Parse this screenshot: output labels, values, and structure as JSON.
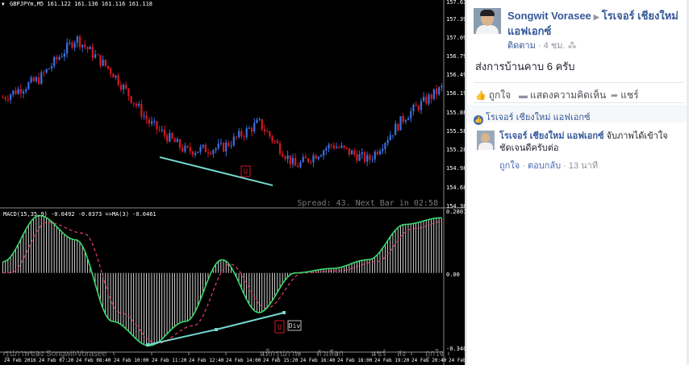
{
  "chart": {
    "symbol_header": "GBPJPYm,M5  161.122 161.136 161.116 161.118",
    "spread_text": "Spread: 43. Next Bar in 02:58",
    "macd_header": "MACD(15,35,9) -0.0492 -0.0373 =>MA(3) -0.0461",
    "price_ticks": [
      "157.630",
      "157.395",
      "157.090",
      "156.790",
      "156.490",
      "156.190",
      "155.885",
      "155.585",
      "155.285",
      "154.985",
      "154.680",
      "154.380"
    ],
    "macd_ticks": [
      "0.2801",
      "0.00",
      "-0.3407"
    ],
    "time_ticks": [
      "24 Feb 2016",
      "24 Feb 07:20",
      "24 Feb 08:40",
      "24 Feb 10:00",
      "24 Feb 11:20",
      "24 Feb 12:40",
      "24 Feb 14:00",
      "24 Feb 15:20",
      "24 Feb 16:40",
      "24 Feb 18:00",
      "24 Feb 19:20",
      "24 Feb 20:40",
      "24 Feb 22:00"
    ],
    "marker_u": "U",
    "marker_div": "Div",
    "watermark": "รูปภาพของ Songwit Vorasee",
    "watermark_menu": [
      "แท็กรูปภาพ",
      "ตัวเลือก",
      "แชร์",
      "ส่ง",
      "ถูกใจ"
    ],
    "colors": {
      "background": "#000000",
      "bull": "#3b6fe0",
      "bear": "#d21a22",
      "trendline": "#76d7d0",
      "macd_line": "#3ad86a",
      "signal_line": "#e0406a",
      "histogram": "#ffffff"
    }
  },
  "chart_data": [
    {
      "type": "candlestick",
      "title": "GBPJPYm,M5",
      "ylim": [
        154.38,
        157.63
      ],
      "x": [
        "24 Feb 2016",
        "24 Feb 07:20",
        "24 Feb 08:40",
        "24 Feb 10:00",
        "24 Feb 11:20",
        "24 Feb 12:40",
        "24 Feb 14:00",
        "24 Feb 15:20",
        "24 Feb 16:40",
        "24 Feb 18:00",
        "24 Feb 19:20",
        "24 Feb 20:40",
        "24 Feb 22:00"
      ],
      "close": [
        156.1,
        156.4,
        157.05,
        156.5,
        155.7,
        155.25,
        155.3,
        155.7,
        155.0,
        155.35,
        155.1,
        155.8,
        156.25
      ],
      "series": [
        {
          "name": "Trendline",
          "values": [
            155.15,
            154.7
          ]
        }
      ],
      "annotations": [
        "U"
      ]
    },
    {
      "type": "line",
      "title": "MACD(15,35,9)",
      "ylim": [
        -0.3407,
        0.2801
      ],
      "x": [
        "24 Feb 2016",
        "24 Feb 07:20",
        "24 Feb 08:40",
        "24 Feb 10:00",
        "24 Feb 11:20",
        "24 Feb 12:40",
        "24 Feb 14:00",
        "24 Feb 15:20",
        "24 Feb 16:40",
        "24 Feb 18:00",
        "24 Feb 19:20",
        "24 Feb 20:40",
        "24 Feb 22:00"
      ],
      "series": [
        {
          "name": "MACD",
          "values": [
            0.05,
            0.26,
            0.15,
            -0.22,
            -0.33,
            -0.22,
            0.06,
            -0.18,
            0.0,
            0.02,
            0.06,
            0.22,
            0.25
          ]
        },
        {
          "name": "MA(3)",
          "values": [
            0.0,
            0.23,
            0.18,
            -0.18,
            -0.32,
            -0.24,
            0.04,
            -0.16,
            0.0,
            0.01,
            0.05,
            0.2,
            0.24
          ]
        }
      ],
      "annotations": [
        "U",
        "Div"
      ]
    }
  ],
  "post": {
    "author": "Songwit Vorasee",
    "target": "โรเจอร์ เชียงใหม่ แอฟเอกซ์",
    "follow": "ติดตาม",
    "time": "4 ชม.",
    "text": "ส่งการบ้านคาบ 6 ครับ",
    "like_label": "ถูกใจ",
    "comment_label": "แสดงความคิดเห็น",
    "share_label": "แชร์",
    "likes_by": "โรเจอร์ เชียงใหม่ แอฟเอกซ์",
    "comment": {
      "author": "โรเจอร์ เชียงใหม่ แอฟเอกซ์",
      "text": "จับภาพได้เข้าใจชัดเจนดีครับต่อ",
      "like": "ถูกใจ",
      "reply": "ตอบกลับ",
      "time": "13 นาที"
    }
  }
}
